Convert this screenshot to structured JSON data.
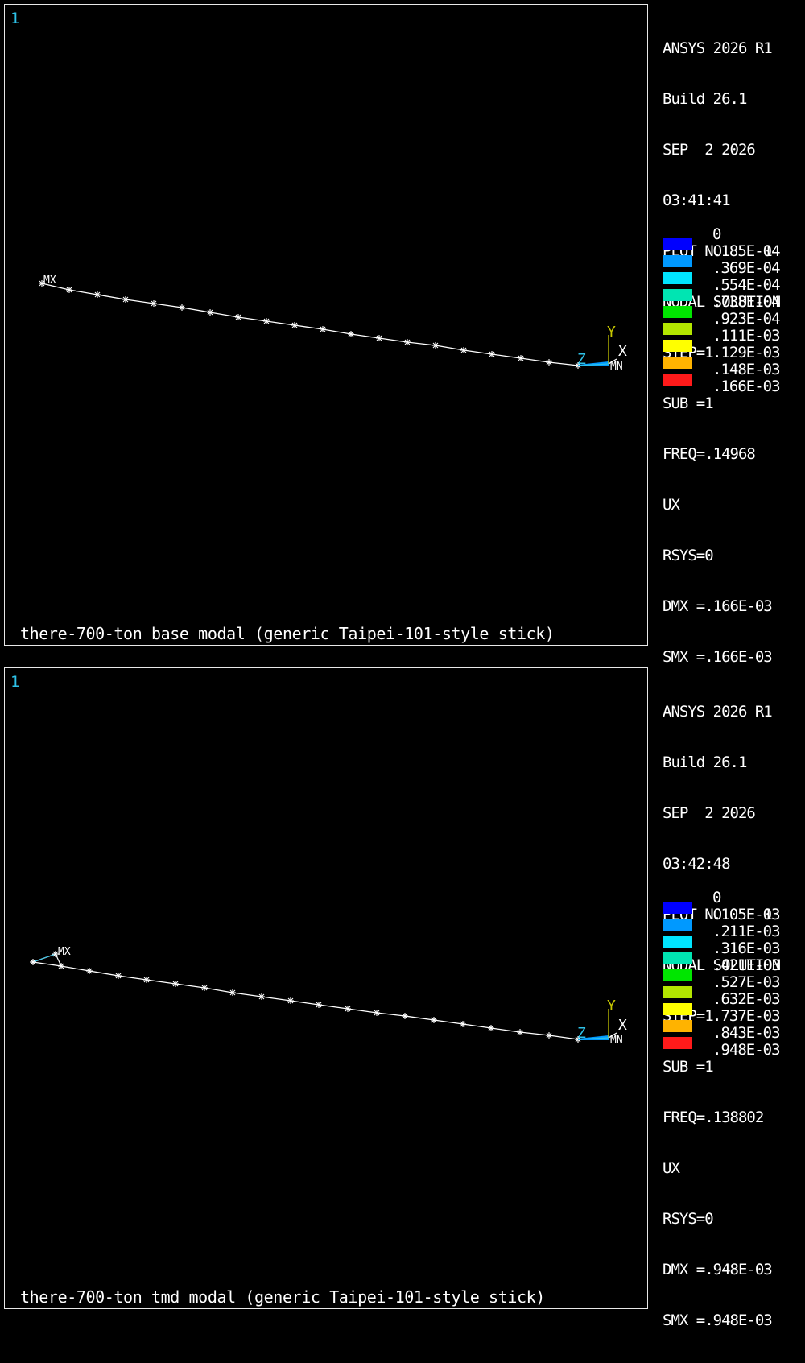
{
  "plots": [
    {
      "window_number": "1",
      "caption": "there-700-ton base modal (generic Taipei-101-style stick)",
      "info": {
        "product": "ANSYS 2026 R1",
        "build": "Build 26.1",
        "date": "SEP  2 2026",
        "time": "03:41:41",
        "plot_no": "PLOT NO.    1",
        "solution": "NODAL SOLUTION",
        "step": "STEP=1",
        "sub": "SUB =1",
        "freq": "FREQ=.14968",
        "item": "UX",
        "rsys": "RSYS=0",
        "dmx": "DMX =.166E-03",
        "smx": "SMX =.166E-03"
      },
      "legend": [
        "0",
        ".185E-04",
        ".369E-04",
        ".554E-04",
        ".738E-04",
        ".923E-04",
        ".111E-03",
        ".129E-03",
        ".148E-03",
        ".166E-03"
      ],
      "mx_label": "MX",
      "mn_label": "MN",
      "axes": {
        "x": "X",
        "y": "Y",
        "z": "Z"
      }
    },
    {
      "window_number": "1",
      "caption": "there-700-ton tmd modal (generic Taipei-101-style stick)",
      "info": {
        "product": "ANSYS 2026 R1",
        "build": "Build 26.1",
        "date": "SEP  2 2026",
        "time": "03:42:48",
        "plot_no": "PLOT NO.    1",
        "solution": "NODAL SOLUTION",
        "step": "STEP=1",
        "sub": "SUB =1",
        "freq": "FREQ=.138802",
        "item": "UX",
        "rsys": "RSYS=0",
        "dmx": "DMX =.948E-03",
        "smx": "SMX =.948E-03"
      },
      "legend": [
        "0",
        ".105E-03",
        ".211E-03",
        ".316E-03",
        ".421E-03",
        ".527E-03",
        ".632E-03",
        ".737E-03",
        ".843E-03",
        ".948E-03"
      ],
      "mx_label": "MX",
      "mn_label": "MN",
      "axes": {
        "x": "X",
        "y": "Y",
        "z": "Z"
      }
    }
  ],
  "colors": {
    "background": "#000000",
    "frame": "#e8e8e8",
    "text": "#ffffff",
    "window_number": "#2ec2e8",
    "triad_y": "#c8c800",
    "triad_z": "#2ec2e8",
    "legend_scale": [
      "#0000ff",
      "#0099ff",
      "#00e5ff",
      "#00e5b2",
      "#00e600",
      "#b3e600",
      "#ffff00",
      "#ffb300",
      "#ff1a1a"
    ]
  }
}
